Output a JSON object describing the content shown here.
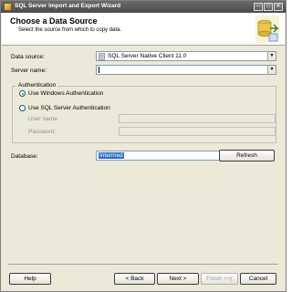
{
  "window": {
    "title": "SQL Server Import and Export Wizard"
  },
  "title_buttons": {
    "minimize": "–",
    "maximize": "□",
    "close": "✕"
  },
  "header": {
    "title": "Choose a Data Source",
    "subtitle": "Select the source from which to copy data.",
    "icon": "wizard-database-icon"
  },
  "form": {
    "data_source_label": "Data source:",
    "data_source_value": "SQL Server Native Client 11.0",
    "server_name_label": "Server name:",
    "server_name_value": "",
    "authentication_label": "Authentication",
    "windows_auth_label": "Use Windows Authentication",
    "sql_auth_label": "Use SQL Server Authentication",
    "username_label": "User name:",
    "password_label": "Password:",
    "database_label": "Database:",
    "database_value": "Intermed",
    "refresh_label": "Refresh"
  },
  "footer": {
    "help": "Help",
    "back": "< Back",
    "next": "Next >",
    "finish": "Finish >>|",
    "cancel": "Cancel"
  }
}
